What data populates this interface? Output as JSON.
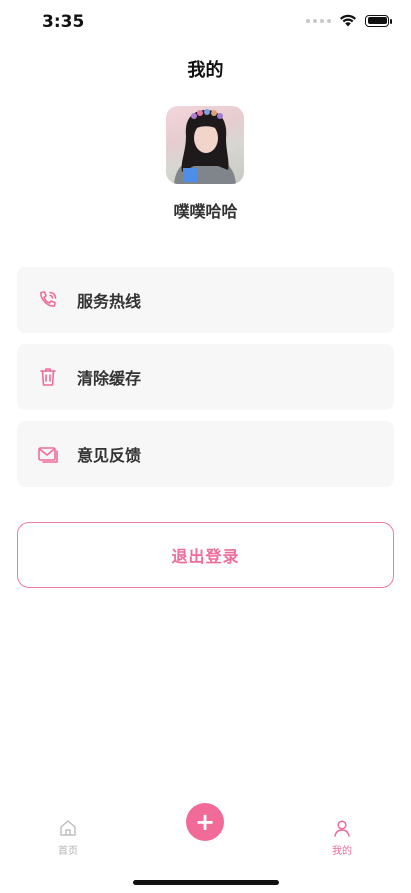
{
  "status_bar": {
    "time": "3:35"
  },
  "header": {
    "title": "我的"
  },
  "profile": {
    "name": "噗噗哈哈"
  },
  "menu": [
    {
      "label": "服务热线",
      "icon": "phone-icon"
    },
    {
      "label": "清除缓存",
      "icon": "trash-icon"
    },
    {
      "label": "意见反馈",
      "icon": "mail-icon"
    }
  ],
  "logout": {
    "label": "退出登录"
  },
  "tabbar": {
    "home_label": "首页",
    "mine_label": "我的",
    "add_label": "+"
  },
  "colors": {
    "accent": "#ef6c9a",
    "card_bg": "#f7f7f7"
  }
}
